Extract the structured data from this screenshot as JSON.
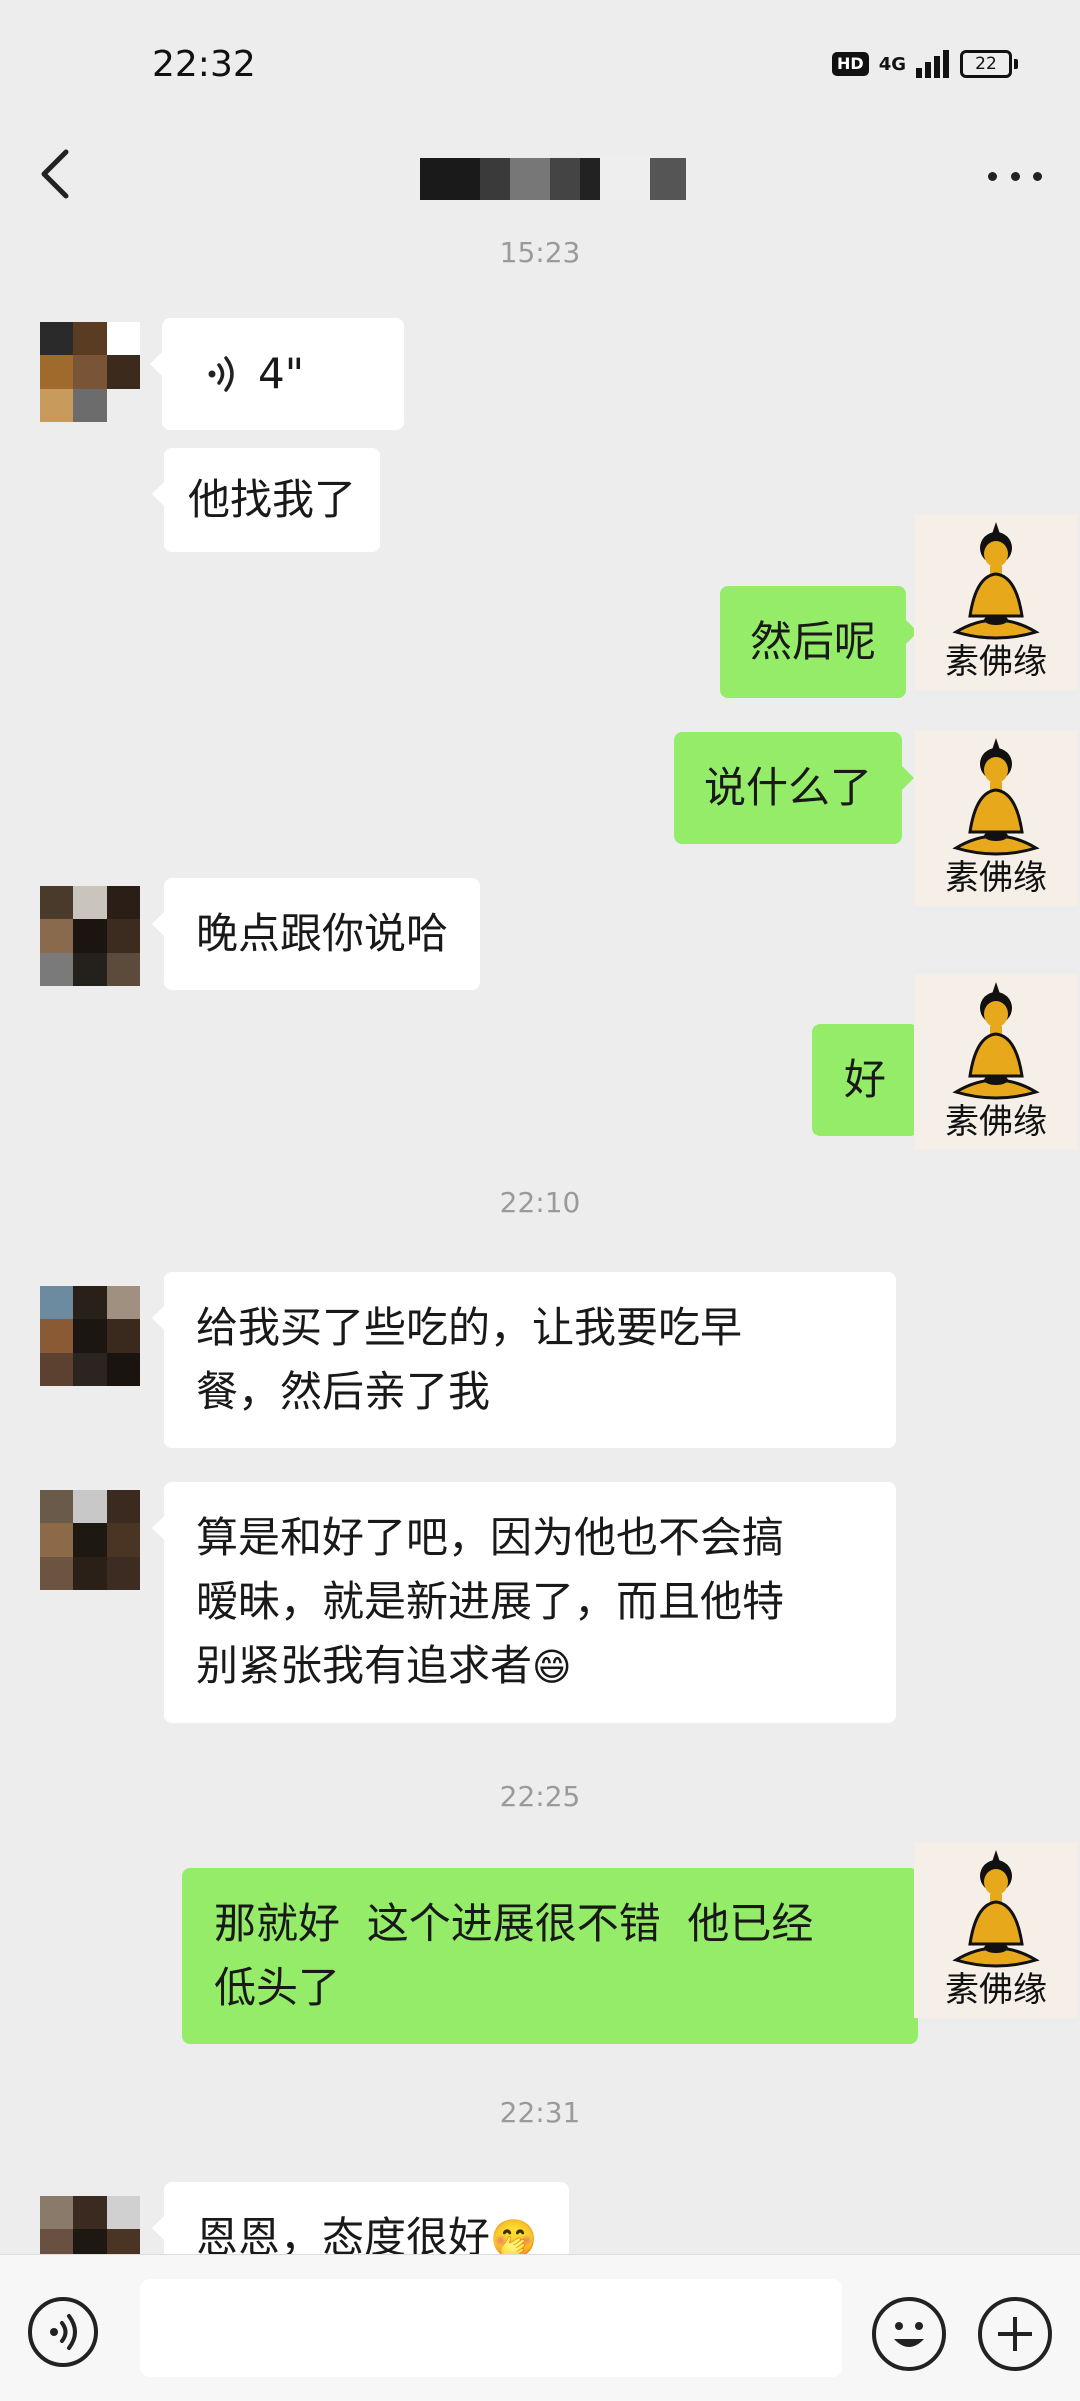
{
  "status_bar": {
    "time": "22:32",
    "hd": "HD",
    "network": "4G",
    "battery": "22"
  },
  "header": {
    "title": "",
    "more_icon": "more-dots-icon",
    "back_icon": "chevron-left-icon"
  },
  "messages": {
    "ts1": "15:23",
    "voice_duration": "4\"",
    "m1": "他找我了",
    "m2": "然后呢",
    "m3": "说什么了",
    "m4": "晚点跟你说哈",
    "m5": "好",
    "ts2": "22:10",
    "m6_line1": "给我买了些吃的，让我要吃早",
    "m6_line2": "餐，然后亲了我",
    "m7_line1": "算是和好了吧，因为他也不会搞",
    "m7_line2": "暧昧，就是新进展了，而且他特",
    "m7_line3": "别紧张我有追求者",
    "m7_emoji": "😄",
    "ts3": "22:25",
    "m8_line1": "那就好  这个进展很不错  他已经",
    "m8_line2": "低头了",
    "ts4": "22:31",
    "m9": "恩恩，态度很好",
    "m9_emoji": "🤭"
  },
  "self_avatar": {
    "label": "素佛缘"
  },
  "input_bar": {
    "input_value": "",
    "voice_icon": "voice-mode-icon",
    "emoji_icon": "emoji-icon",
    "plus_icon": "plus-icon"
  },
  "colors": {
    "background": "#ededed",
    "sent_bubble": "#95ec69",
    "received_bubble": "#ffffff",
    "timestamp": "#9a9a9a"
  }
}
